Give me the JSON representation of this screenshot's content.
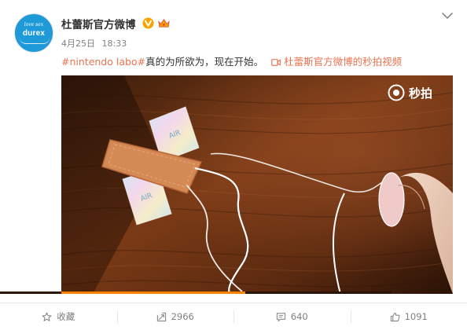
{
  "account": {
    "avatar_tagline": "love sex",
    "avatar_brand": "durex",
    "name": "杜蕾斯官方微博",
    "date": "4月25日",
    "time": "18:33"
  },
  "post": {
    "hashtag": "#nintendo labo#",
    "text": "真的为所欲为，现在开始。",
    "video_link": "杜蕾斯官方微博的秒拍视频"
  },
  "media": {
    "watermark": "秒拍",
    "progress": 0.47,
    "package_label": "AIR"
  },
  "actions": {
    "favorite_label": "收藏",
    "repost_count": "2966",
    "comment_count": "640",
    "like_count": "1091"
  },
  "colors": {
    "link": "#eb7350",
    "verified": "#f7a300",
    "progress": "#ff8200"
  }
}
